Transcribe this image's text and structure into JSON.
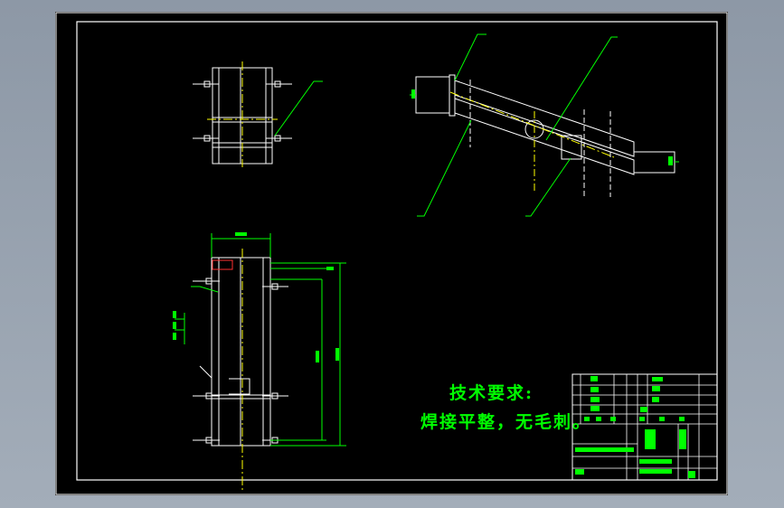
{
  "technical_requirements": {
    "title": "技术要求:",
    "line1": "焊接平整，无毛刺。"
  },
  "colors": {
    "background": "#000000",
    "frame": "#ffffff",
    "dimension": "#00ff00",
    "centerline": "#ffff00",
    "hatch": "#ff3030"
  }
}
